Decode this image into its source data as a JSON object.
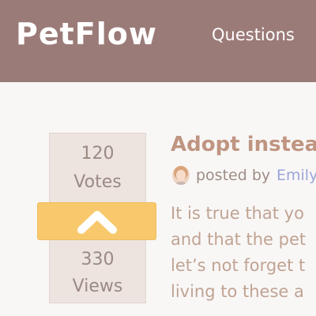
{
  "navbar": {
    "logo": "PetFlow",
    "links": [
      "Questions"
    ]
  },
  "post": {
    "votes_count": "120",
    "votes_label": "Votes",
    "views_count": "330",
    "views_label": "Views",
    "title": "Adopt instea",
    "posted_by_label": "posted by",
    "author": "Emily",
    "excerpt_lines": [
      "It is true that yo",
      "and that the pet",
      "let’s not forget t",
      "living to these a"
    ]
  },
  "colors": {
    "navbar_bg": "#9b7b78",
    "upvote_button": "#f8c96c",
    "title": "#bf9581",
    "author_link": "#9aa6d8"
  },
  "icons": {
    "upvote": "chevron-up-icon",
    "avatar": "user-avatar"
  }
}
